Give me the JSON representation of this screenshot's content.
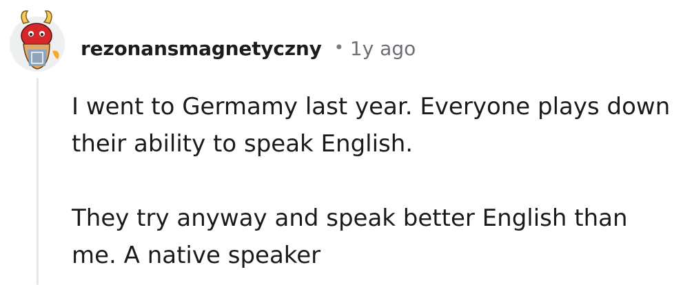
{
  "comment": {
    "author": "rezonansmagnetyczny",
    "separator": "•",
    "timestamp": "1y ago",
    "avatar": {
      "icon": "snoo-avatar-icon",
      "colors": [
        "#d4272a",
        "#f3c95b",
        "#7ea3c9",
        "#ffffff"
      ]
    },
    "paragraphs": [
      "I went to Germamy last year. Everyone plays down their ability to speak English.",
      "They try anyway and speak better English than me. A native speaker"
    ]
  }
}
